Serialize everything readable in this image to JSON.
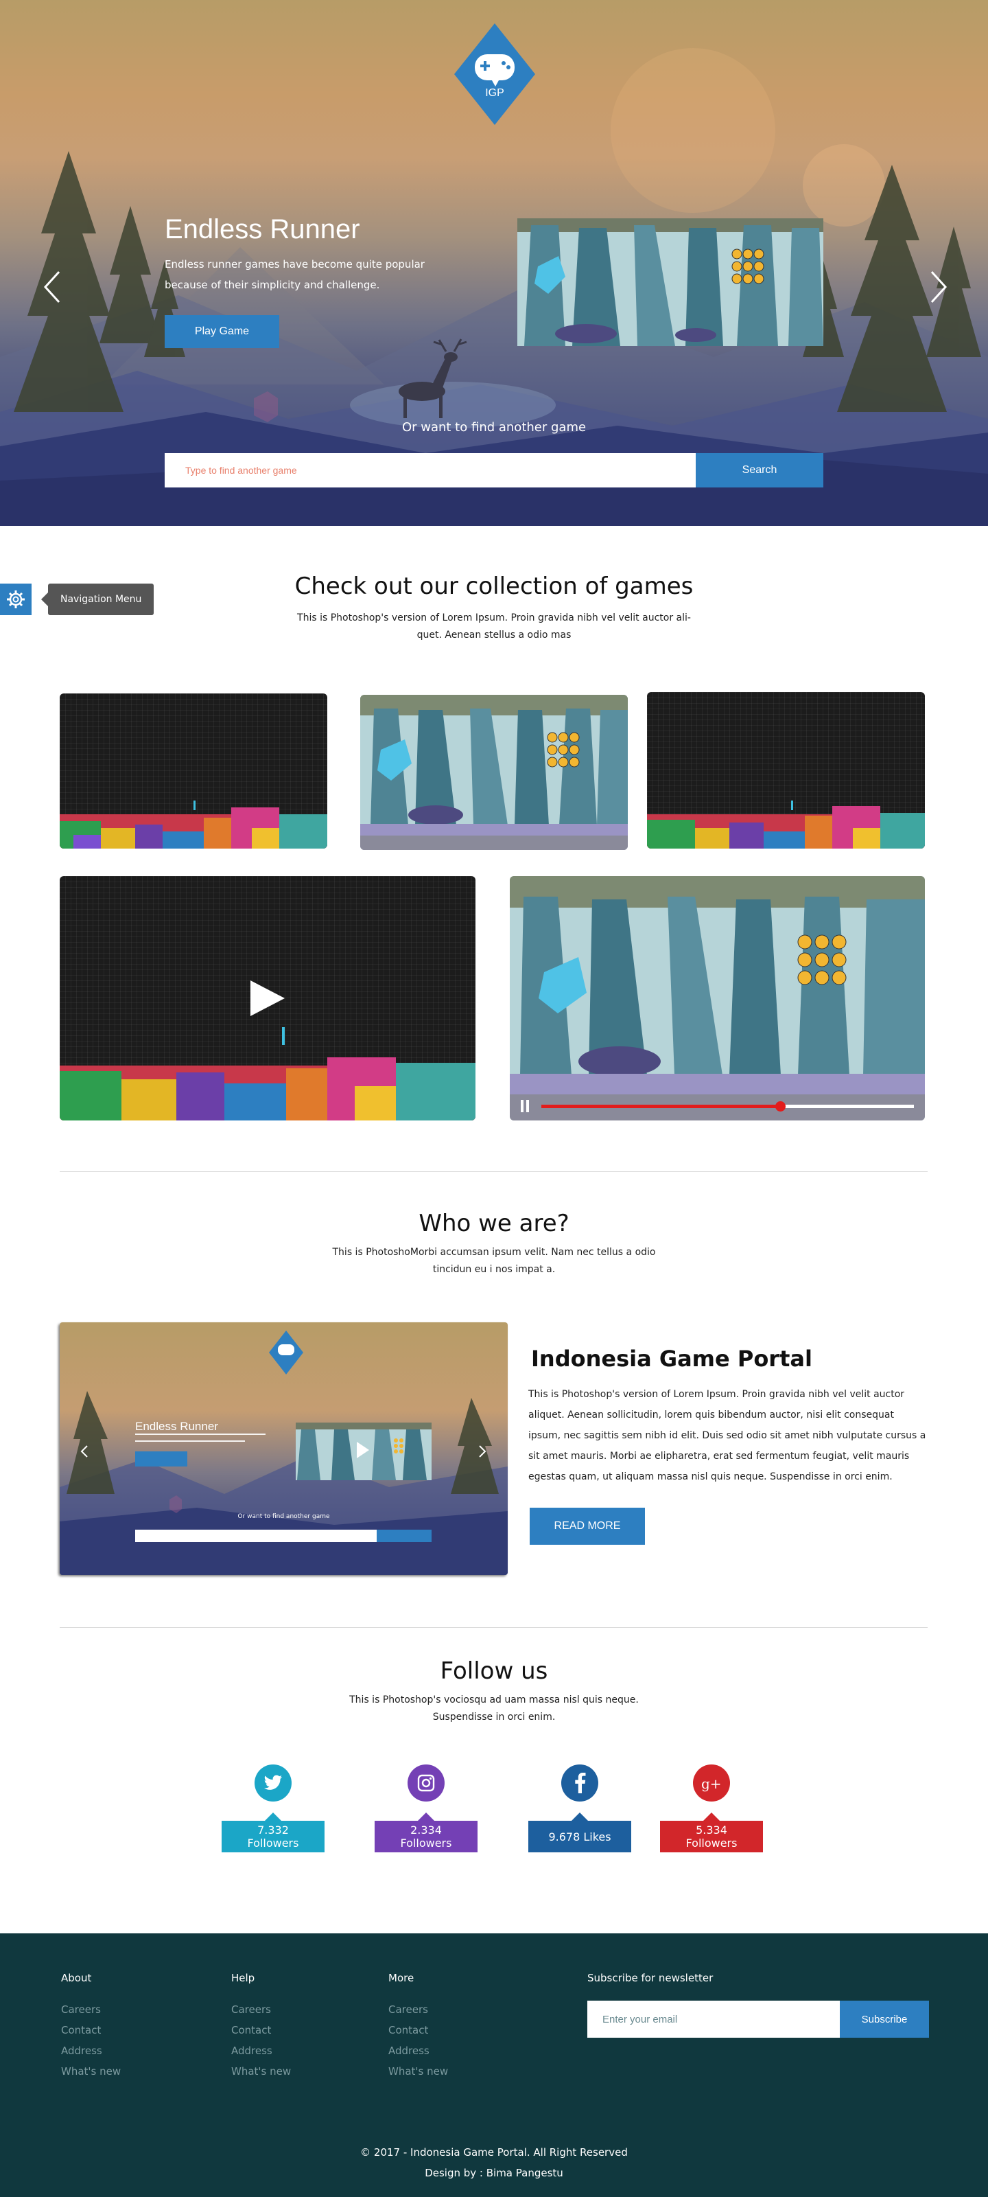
{
  "hero": {
    "logo_text": "IGP",
    "title": "Endless Runner",
    "description": "Endless runner games have become quite popular because of their simplicity and challenge.",
    "play_button": "Play Game",
    "find_label": "Or want to find another game",
    "search_placeholder": "Type to find another game",
    "search_button": "Search"
  },
  "nav": {
    "tooltip": "Navigation Menu",
    "icon": "gear-icon"
  },
  "collection": {
    "title": "Check out our collection of games",
    "subtitle": "This is Photoshop's version  of Lorem Ipsum. Proin gravida nibh vel velit auctor ali-quet. Aenean stellus a odio mas",
    "video_progress": 0.64
  },
  "who": {
    "title": "Who we are?",
    "subtitle": "This is PhotoshoMorbi accumsan ipsum velit. Nam nec tellus a odio tincidun eu i nos  impat a.",
    "heading": "Indonesia Game Portal",
    "text": "This is Photoshop's version  of Lorem Ipsum. Proin gravida nibh vel velit auctor aliquet. Aenean sollicitudin, lorem quis bibendum auctor, nisi elit consequat ipsum, nec sagittis sem nibh id elit. Duis sed odio sit amet nibh vulputate cursus a sit amet mauris. Morbi ae elipharetra, erat sed fermentum feugiat, velit mauris egestas quam, ut aliquam massa nisl quis neque. Suspendisse in orci enim.",
    "button": "READ MORE"
  },
  "follow": {
    "title": "Follow us",
    "subtitle": "This is Photoshop's vociosqu ad uam massa nisl quis neque. Suspendisse in orci enim.",
    "items": [
      {
        "icon": "twitter-icon",
        "label": "7.332 Followers",
        "color": "#1ba6c7"
      },
      {
        "icon": "instagram-icon",
        "label": "2.334 Followers",
        "color": "#7440b5"
      },
      {
        "icon": "facebook-icon",
        "label": "9.678 Likes",
        "color": "#1d5f9e"
      },
      {
        "icon": "google-plus-icon",
        "label": "5.334 Followers",
        "color": "#d2262a"
      }
    ]
  },
  "footer": {
    "columns": [
      {
        "title": "About",
        "links": [
          "Careers",
          "Contact",
          "Address",
          "What's new"
        ]
      },
      {
        "title": "Help",
        "links": [
          "Careers",
          "Contact",
          "Address",
          "What's new"
        ]
      },
      {
        "title": "More",
        "links": [
          "Careers",
          "Contact",
          "Address",
          "What's new"
        ]
      }
    ],
    "subscribe_title": "Subscribe for newsletter",
    "email_placeholder": "Enter your email",
    "subscribe_button": "Subscribe",
    "copyright": "© 2017 - Indonesia Game Portal. All Right Reserved",
    "credit": "Design by : Bima Pangestu"
  },
  "colors": {
    "accent": "#2d7fc1",
    "footer_bg": "#10383e"
  }
}
